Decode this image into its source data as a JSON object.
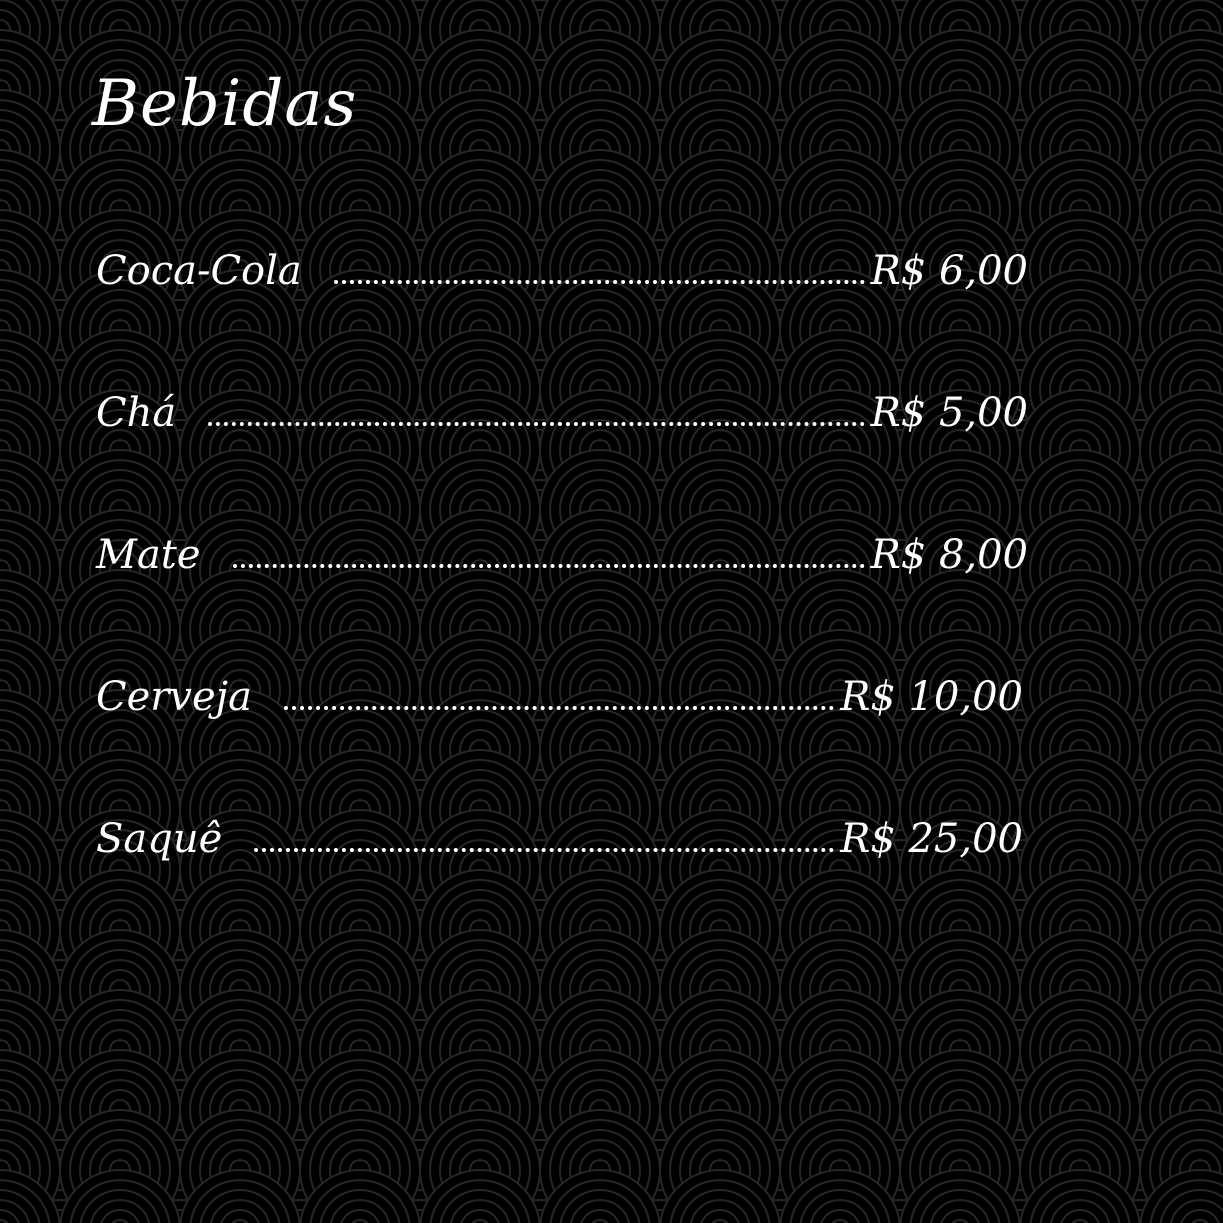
{
  "menu": {
    "title": "Bebidas",
    "items": [
      {
        "name": "Coca-Cola",
        "price": "R$ 6,00"
      },
      {
        "name": "Chá",
        "price": "R$ 5,00"
      },
      {
        "name": "Mate",
        "price": "R$ 8,00"
      },
      {
        "name": "Cerveja",
        "price": "R$ 10,00"
      },
      {
        "name": "Saquê",
        "price": "R$ 25,00"
      }
    ]
  },
  "colors": {
    "background": "#000000",
    "text": "#ffffff",
    "pattern_line": "#2a2a2a"
  },
  "decoration": {
    "background_pattern": "seigaiha-wave-pattern"
  }
}
